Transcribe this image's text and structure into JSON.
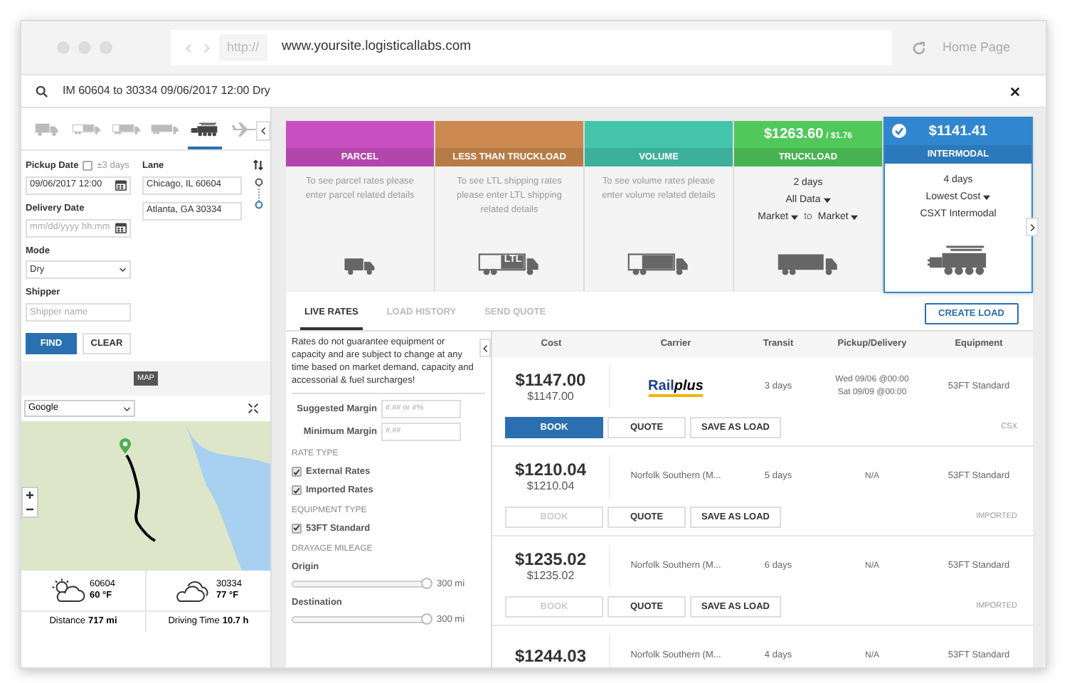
{
  "browser": {
    "scheme": "http://",
    "url": "www.yoursite.logisticallabs.com",
    "home": "Home Page"
  },
  "search": {
    "value": "IM 60604 to 30334 09/06/2017 12:00 Dry"
  },
  "modes": [
    {
      "kind": "small-truck",
      "selected": false
    },
    {
      "kind": "ltl-truck",
      "selected": false
    },
    {
      "kind": "box-truck",
      "selected": false
    },
    {
      "kind": "semi-truck",
      "selected": false
    },
    {
      "kind": "locomotive",
      "selected": true
    },
    {
      "kind": "airplane",
      "selected": false
    }
  ],
  "form": {
    "pickup_label": "Pickup Date",
    "flex_label": "±3 days",
    "flex_checked": false,
    "pickup_value": "09/06/2017 12:00",
    "delivery_label": "Delivery Date",
    "delivery_placeholder": "mm/dd/yyyy hh:mm",
    "mode_label": "Mode",
    "mode_value": "Dry",
    "shipper_label": "Shipper",
    "shipper_placeholder": "Shipper name",
    "lane_label": "Lane",
    "origin": "Chicago, IL 60604",
    "destination": "Atlanta, GA 30334",
    "find": "FIND",
    "clear": "CLEAR"
  },
  "map": {
    "tag": "MAP",
    "provider": "Google"
  },
  "weather": [
    {
      "kind": "partly-sunny",
      "zip": "60604",
      "temp": "60 °F"
    },
    {
      "kind": "cloudy",
      "zip": "30334",
      "temp": "77 °F"
    }
  ],
  "stats": [
    {
      "label": "Distance",
      "value": "717 mi"
    },
    {
      "label": "Driving Time",
      "value": "10.7 h"
    }
  ],
  "services": [
    {
      "name": "PARCEL",
      "color": "#c84fc0",
      "kind": "small-truck",
      "selected": false,
      "message": "To see parcel rates please enter parcel related details"
    },
    {
      "name": "LESS THAN TRUCKLOAD",
      "color": "#cc8a50",
      "kind": "ltl-truck",
      "icon_text": "LTL",
      "selected": false,
      "message": "To see LTL shipping rates please enter LTL shipping related details"
    },
    {
      "name": "VOLUME",
      "color": "#45c4ac",
      "kind": "box-truck",
      "selected": false,
      "message": "To see volume rates please enter volume related details"
    },
    {
      "name": "TRUCKLOAD",
      "color": "#50c85a",
      "kind": "semi-truck",
      "selected": false,
      "price": "$1263.60",
      "per": "/ $1.76",
      "transit": "2 days",
      "filter": "All Data",
      "from": "Market",
      "joiner": "to",
      "to": "Market"
    },
    {
      "name": "INTERMODAL",
      "color": "#3087d0",
      "kind": "locomotive",
      "selected": true,
      "price": "$1141.41",
      "transit": "4 days",
      "sort": "Lowest Cost",
      "carrier": "CSXT Intermodal"
    }
  ],
  "tabs": [
    {
      "label": "LIVE RATES",
      "selected": true
    },
    {
      "label": "LOAD HISTORY",
      "selected": false
    },
    {
      "label": "SEND QUOTE",
      "selected": false
    }
  ],
  "create_load": "CREATE LOAD",
  "filters": {
    "notice": "Rates do not guarantee equipment or capacity and are subject to change at any time based on market demand, capacity and accessorial & fuel surcharges!",
    "margins": [
      {
        "label": "Suggested Margin",
        "placeholder": "#.## or #%"
      },
      {
        "label": "Minimum Margin",
        "placeholder": "#.##"
      }
    ],
    "groups": [
      {
        "title": "RATE TYPE",
        "options": [
          {
            "label": "External Rates",
            "checked": true
          },
          {
            "label": "Imported Rates",
            "checked": true
          }
        ]
      },
      {
        "title": "EQUIPMENT TYPE",
        "options": [
          {
            "label": "53FT Standard",
            "checked": true
          }
        ]
      }
    ],
    "mileage_title": "DRAYAGE MILEAGE",
    "sliders": [
      {
        "label": "Origin",
        "level": 1,
        "reading": "300 mi"
      },
      {
        "label": "Destination",
        "level": 1,
        "reading": "300 mi"
      }
    ]
  },
  "table": {
    "columns": [
      "Cost",
      "Carrier",
      "Transit",
      "Pickup/Delivery",
      "Equipment"
    ],
    "rows": [
      {
        "cost": "$1147.00",
        "cost_sub": "$1147.00",
        "kind": "logo",
        "carrier": [
          "Rail",
          "plus"
        ],
        "transit": "3 days",
        "pickup": [
          "Wed 09/06 @00:00",
          "Sat 09/09 @00:00"
        ],
        "equipment": "53FT Standard",
        "source": "CSX",
        "book_enabled": true,
        "actions": [
          "BOOK",
          "QUOTE",
          "SAVE AS LOAD"
        ]
      },
      {
        "cost": "$1210.04",
        "cost_sub": "$1210.04",
        "kind": "text",
        "carrier": [
          "Norfolk Southern (M..."
        ],
        "transit": "5 days",
        "pickup": [
          "N/A"
        ],
        "equipment": "53FT Standard",
        "source": "IMPORTED",
        "book_enabled": false,
        "actions": [
          "BOOK",
          "QUOTE",
          "SAVE AS LOAD"
        ]
      },
      {
        "cost": "$1235.02",
        "cost_sub": "$1235.02",
        "kind": "text",
        "carrier": [
          "Norfolk Southern (M..."
        ],
        "transit": "6 days",
        "pickup": [
          "N/A"
        ],
        "equipment": "53FT Standard",
        "source": "IMPORTED",
        "book_enabled": false,
        "actions": [
          "BOOK",
          "QUOTE",
          "SAVE AS LOAD"
        ]
      },
      {
        "cost": "$1244.03",
        "kind": "text",
        "carrier": [
          "Norfolk Southern (M..."
        ],
        "transit": "4 days",
        "pickup": [
          "N/A"
        ],
        "equipment": "53FT Standard"
      }
    ]
  }
}
